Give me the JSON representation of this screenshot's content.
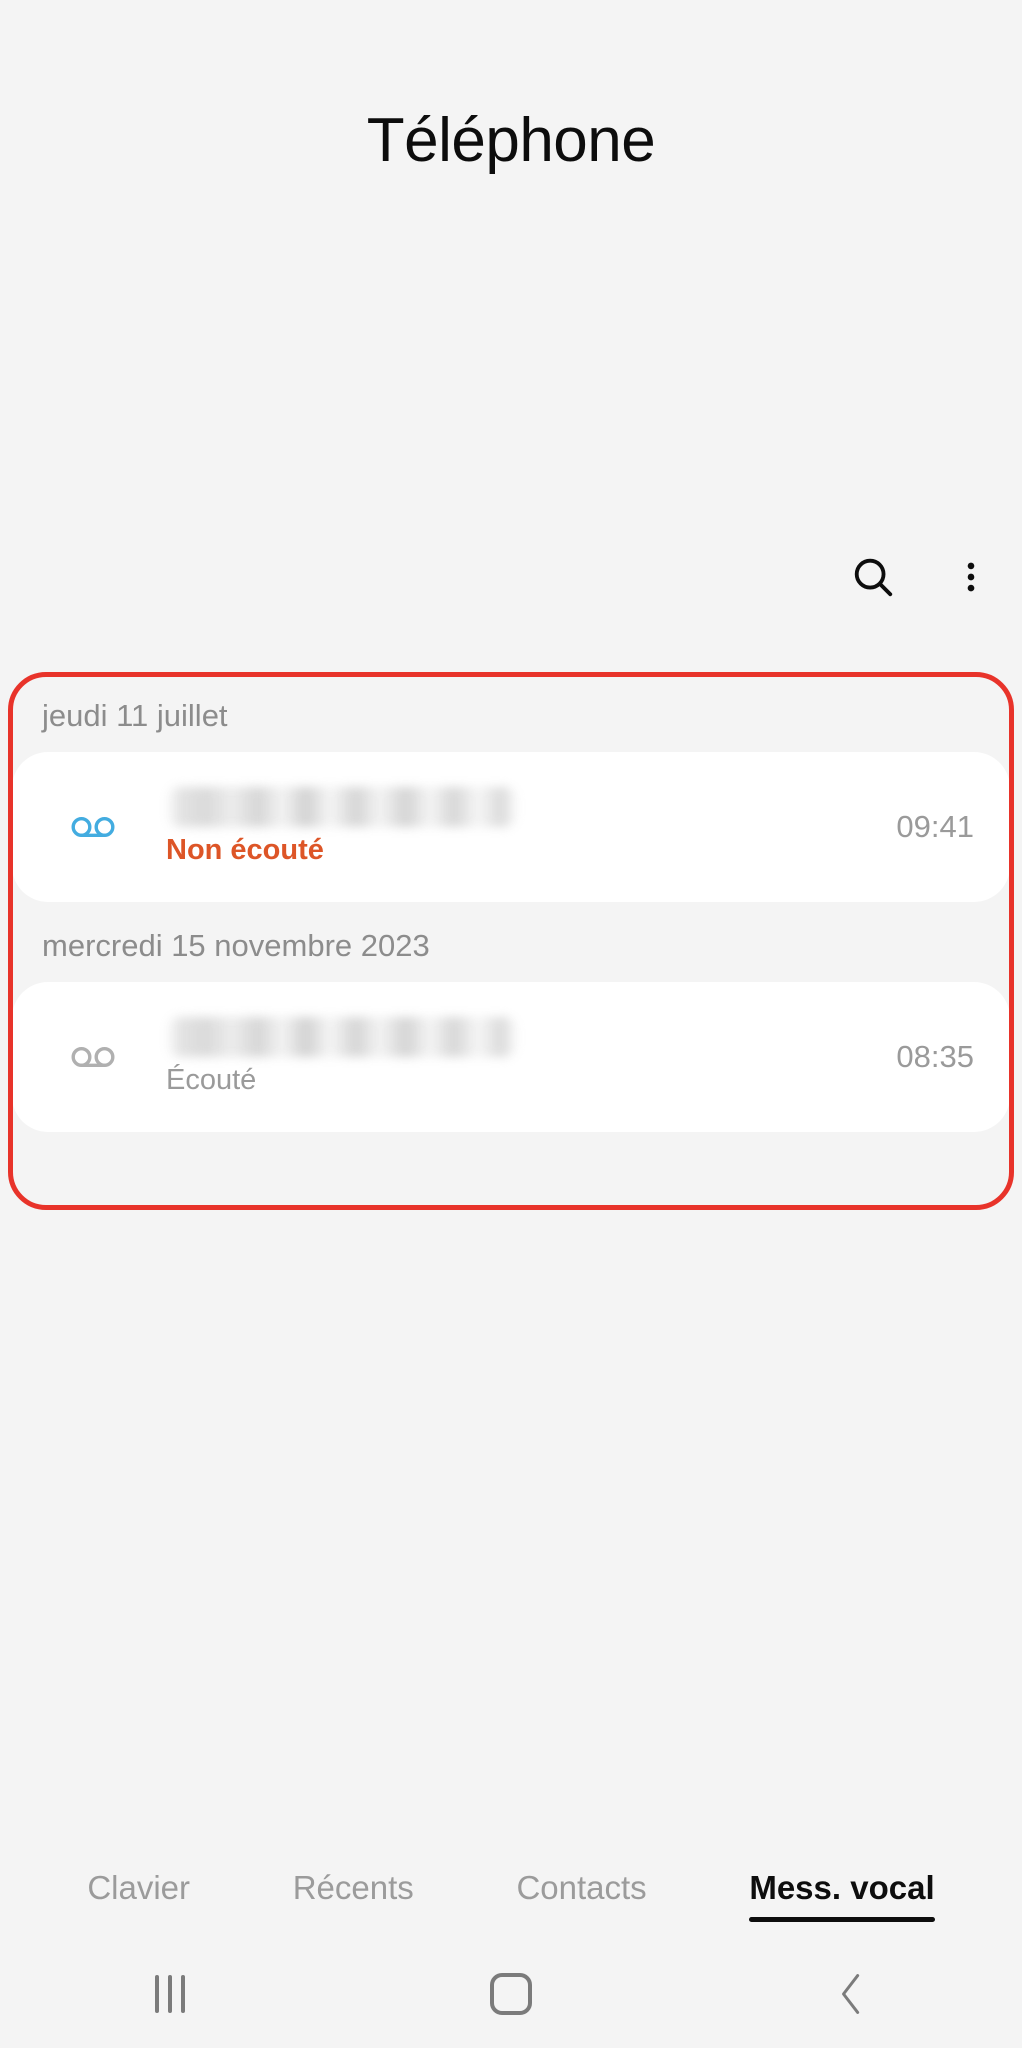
{
  "header": {
    "title": "Téléphone"
  },
  "toolbar": {
    "search_icon": "search-icon",
    "more_icon": "more-vertical-icon"
  },
  "voicemail": {
    "groups": [
      {
        "date": "jeudi 11 juillet",
        "items": [
          {
            "icon": "voicemail-icon",
            "number": "",
            "number_redacted": true,
            "status": "Non écouté",
            "status_type": "unread",
            "time": "09:41"
          }
        ]
      },
      {
        "date": "mercredi 15 novembre 2023",
        "items": [
          {
            "icon": "voicemail-icon",
            "number": "",
            "number_redacted": true,
            "status": "Écouté",
            "status_type": "read",
            "time": "08:35"
          }
        ]
      }
    ]
  },
  "tabs": [
    {
      "label": "Clavier",
      "active": false
    },
    {
      "label": "Récents",
      "active": false
    },
    {
      "label": "Contacts",
      "active": false
    },
    {
      "label": "Mess. vocal",
      "active": true
    }
  ],
  "navbar": {
    "recents_icon": "recents-icon",
    "home_icon": "home-icon",
    "back_icon": "back-chevron-icon"
  },
  "colors": {
    "background": "#f4f4f4",
    "card": "#ffffff",
    "unread_accent": "#dd5527",
    "voicemail_unread_icon": "#43ace0",
    "voicemail_read_icon": "#b0b0b0",
    "muted_text": "#9a9a9a",
    "annotation_border": "#e8332a",
    "primary_text": "#0d0d0d"
  }
}
